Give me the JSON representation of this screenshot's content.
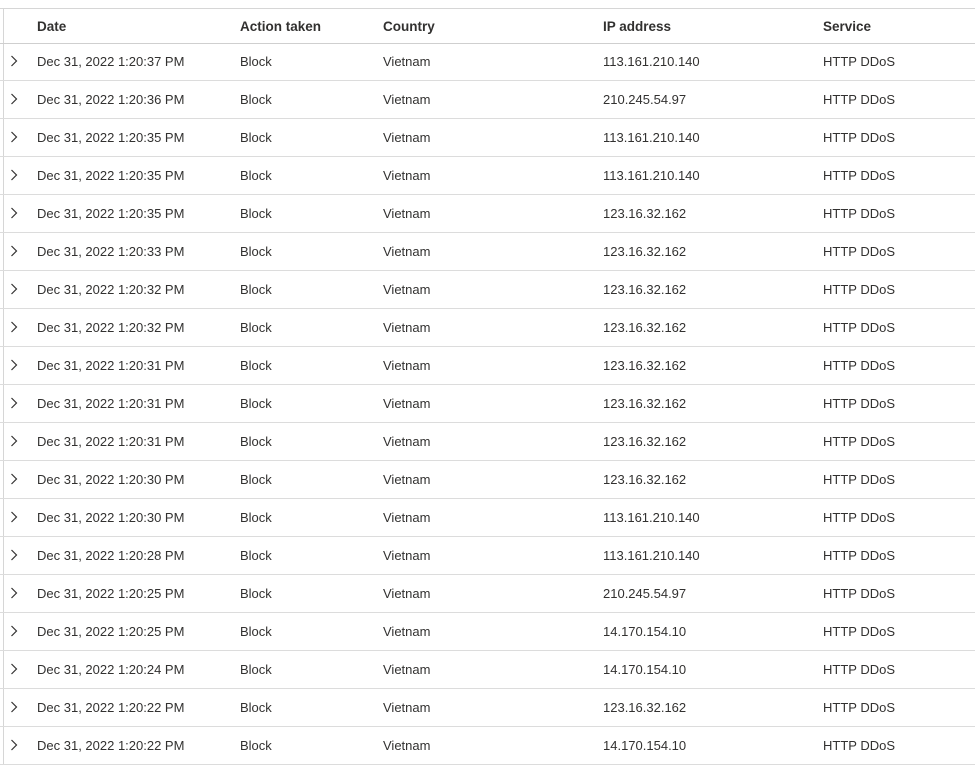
{
  "table": {
    "columns": {
      "date": "Date",
      "action": "Action taken",
      "country": "Country",
      "ip": "IP address",
      "service": "Service"
    },
    "rows": [
      {
        "date": "Dec 31, 2022 1:20:37 PM",
        "action": "Block",
        "country": "Vietnam",
        "ip": "113.161.210.140",
        "service": "HTTP DDoS"
      },
      {
        "date": "Dec 31, 2022 1:20:36 PM",
        "action": "Block",
        "country": "Vietnam",
        "ip": "210.245.54.97",
        "service": "HTTP DDoS"
      },
      {
        "date": "Dec 31, 2022 1:20:35 PM",
        "action": "Block",
        "country": "Vietnam",
        "ip": "113.161.210.140",
        "service": "HTTP DDoS"
      },
      {
        "date": "Dec 31, 2022 1:20:35 PM",
        "action": "Block",
        "country": "Vietnam",
        "ip": "113.161.210.140",
        "service": "HTTP DDoS"
      },
      {
        "date": "Dec 31, 2022 1:20:35 PM",
        "action": "Block",
        "country": "Vietnam",
        "ip": "123.16.32.162",
        "service": "HTTP DDoS"
      },
      {
        "date": "Dec 31, 2022 1:20:33 PM",
        "action": "Block",
        "country": "Vietnam",
        "ip": "123.16.32.162",
        "service": "HTTP DDoS"
      },
      {
        "date": "Dec 31, 2022 1:20:32 PM",
        "action": "Block",
        "country": "Vietnam",
        "ip": "123.16.32.162",
        "service": "HTTP DDoS"
      },
      {
        "date": "Dec 31, 2022 1:20:32 PM",
        "action": "Block",
        "country": "Vietnam",
        "ip": "123.16.32.162",
        "service": "HTTP DDoS"
      },
      {
        "date": "Dec 31, 2022 1:20:31 PM",
        "action": "Block",
        "country": "Vietnam",
        "ip": "123.16.32.162",
        "service": "HTTP DDoS"
      },
      {
        "date": "Dec 31, 2022 1:20:31 PM",
        "action": "Block",
        "country": "Vietnam",
        "ip": "123.16.32.162",
        "service": "HTTP DDoS"
      },
      {
        "date": "Dec 31, 2022 1:20:31 PM",
        "action": "Block",
        "country": "Vietnam",
        "ip": "123.16.32.162",
        "service": "HTTP DDoS"
      },
      {
        "date": "Dec 31, 2022 1:20:30 PM",
        "action": "Block",
        "country": "Vietnam",
        "ip": "123.16.32.162",
        "service": "HTTP DDoS"
      },
      {
        "date": "Dec 31, 2022 1:20:30 PM",
        "action": "Block",
        "country": "Vietnam",
        "ip": "113.161.210.140",
        "service": "HTTP DDoS"
      },
      {
        "date": "Dec 31, 2022 1:20:28 PM",
        "action": "Block",
        "country": "Vietnam",
        "ip": "113.161.210.140",
        "service": "HTTP DDoS"
      },
      {
        "date": "Dec 31, 2022 1:20:25 PM",
        "action": "Block",
        "country": "Vietnam",
        "ip": "210.245.54.97",
        "service": "HTTP DDoS"
      },
      {
        "date": "Dec 31, 2022 1:20:25 PM",
        "action": "Block",
        "country": "Vietnam",
        "ip": "14.170.154.10",
        "service": "HTTP DDoS"
      },
      {
        "date": "Dec 31, 2022 1:20:24 PM",
        "action": "Block",
        "country": "Vietnam",
        "ip": "14.170.154.10",
        "service": "HTTP DDoS"
      },
      {
        "date": "Dec 31, 2022 1:20:22 PM",
        "action": "Block",
        "country": "Vietnam",
        "ip": "123.16.32.162",
        "service": "HTTP DDoS"
      },
      {
        "date": "Dec 31, 2022 1:20:22 PM",
        "action": "Block",
        "country": "Vietnam",
        "ip": "14.170.154.10",
        "service": "HTTP DDoS"
      }
    ]
  }
}
